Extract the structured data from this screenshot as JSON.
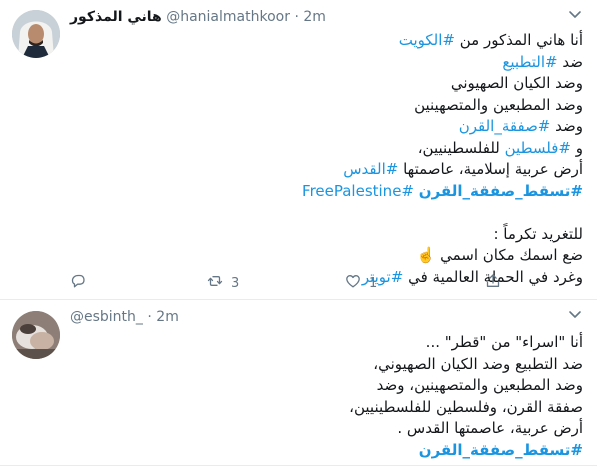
{
  "tweets": [
    {
      "display_name": "هاني المذكور",
      "handle": "@hanialmathkoor",
      "separator": "·",
      "time": "2m",
      "lines": [
        [
          {
            "t": "أنا هاني المذكور من "
          },
          {
            "t": "#الكويت",
            "link": true
          }
        ],
        [
          {
            "t": "ضد "
          },
          {
            "t": "#التطبيع",
            "link": true
          }
        ],
        [
          {
            "t": "وضد الكيان الصهيوني"
          }
        ],
        [
          {
            "t": "وضد المطبعين والمتصهينين"
          }
        ],
        [
          {
            "t": "وضد "
          },
          {
            "t": "#صفقة_القرن",
            "link": true
          }
        ],
        [
          {
            "t": "و "
          },
          {
            "t": "#فلسطين",
            "link": true
          },
          {
            "t": " للفلسطينيين،"
          }
        ],
        [
          {
            "t": "أرض عربية إسلامية، عاصمتها "
          },
          {
            "t": "#القدس",
            "link": true
          }
        ],
        [
          {
            "t": "#تسقط_صفقة_القرن",
            "bold": true
          },
          {
            "t": " "
          },
          {
            "t": "#FreePalestine",
            "link": true
          }
        ],
        [],
        [
          {
            "t": "للتغريد تكرماً :"
          }
        ],
        [
          {
            "t": "ضع اسمك مكان اسمي ☝️"
          }
        ],
        [
          {
            "t": "وغرد في الحملة العالمية في "
          },
          {
            "t": "#تويتر",
            "link": true
          }
        ]
      ],
      "actions": {
        "reply_count": "",
        "retweet_count": "3",
        "like_count": "1"
      }
    },
    {
      "display_name": "",
      "handle": "@esbinth_",
      "separator": "·",
      "time": "2m",
      "lines": [
        [
          {
            "t": "أنا \"اسراء\" من \"قطر\" ..."
          }
        ],
        [
          {
            "t": "ضد التطبيع وضد الكيان الصهيوني،"
          }
        ],
        [
          {
            "t": "وضد المطبعين والمتصهينين، وضد"
          }
        ],
        [
          {
            "t": "صفقة القرن، وفلسطين للفلسطينيين،"
          }
        ],
        [
          {
            "t": "أرض عربية، عاصمتها القدس ."
          }
        ],
        [
          {
            "t": "#تسقط_صفقة_القرن",
            "bold": true
          }
        ]
      ]
    }
  ],
  "icons": {
    "caret": "chevron-down-icon",
    "reply": "reply-icon",
    "retweet": "retweet-icon",
    "like": "heart-icon",
    "share": "share-icon"
  },
  "colors": {
    "link": "#1b95e0",
    "muted": "#657786",
    "border": "#e6ecf0"
  }
}
